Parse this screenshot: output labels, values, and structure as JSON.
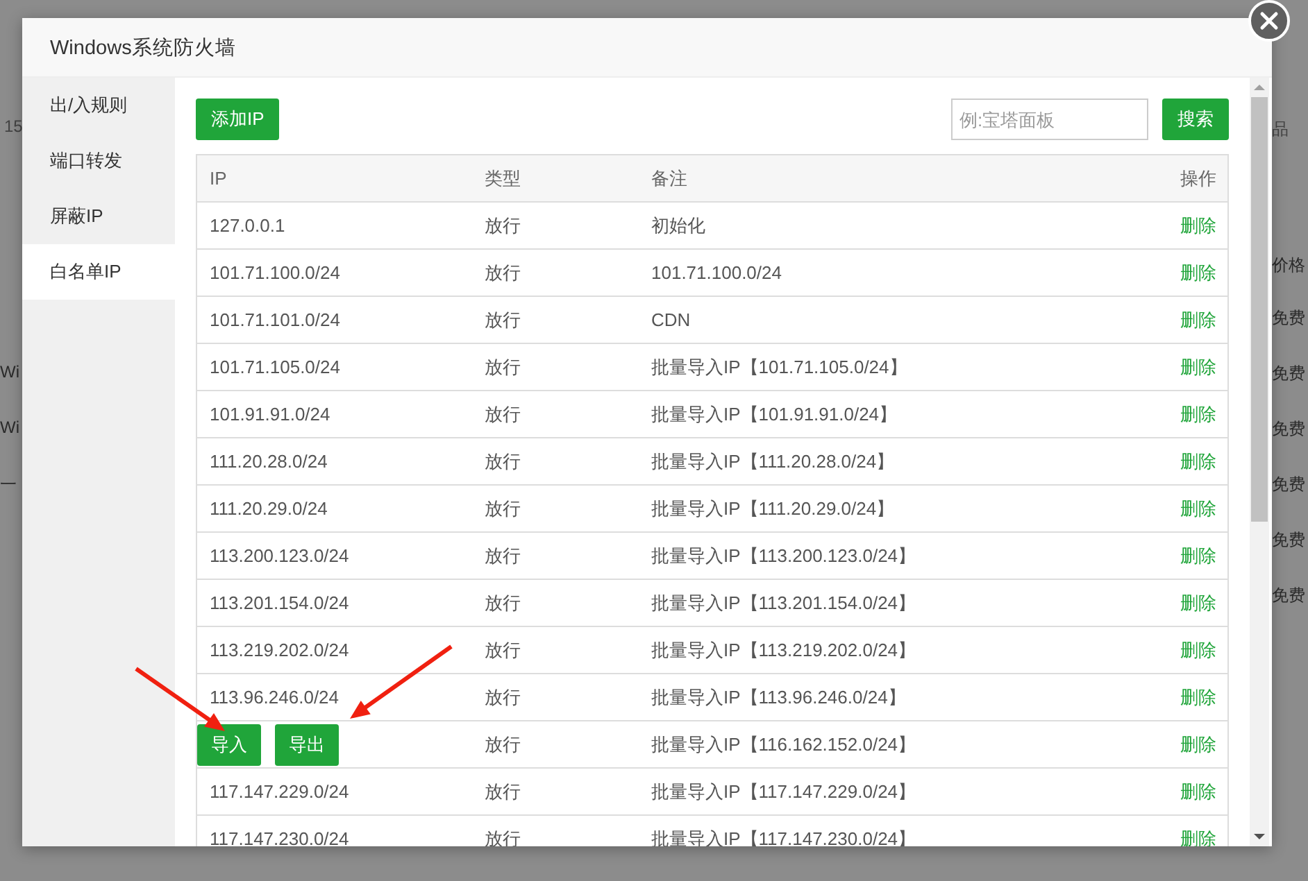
{
  "background": {
    "left_texts": [
      "15",
      "Wi",
      "Wi",
      "一"
    ],
    "right_texts": [
      "品",
      "价格",
      "免费",
      "免费",
      "免费",
      "免费",
      "免费",
      "免费"
    ]
  },
  "dialog": {
    "title": "Windows系统防火墙",
    "sidebar": [
      {
        "label": "出/入规则",
        "selected": false
      },
      {
        "label": "端口转发",
        "selected": false
      },
      {
        "label": "屏蔽IP",
        "selected": false
      },
      {
        "label": "白名单IP",
        "selected": true
      }
    ],
    "add_button": "添加IP",
    "search": {
      "placeholder": "例:宝塔面板"
    },
    "search_button": "搜索",
    "table": {
      "columns": [
        "IP",
        "类型",
        "备注",
        "操作"
      ],
      "rows": [
        {
          "ip": "127.0.0.1",
          "type": "放行",
          "note": "初始化",
          "action": "删除"
        },
        {
          "ip": "101.71.100.0/24",
          "type": "放行",
          "note": "101.71.100.0/24",
          "action": "删除"
        },
        {
          "ip": "101.71.101.0/24",
          "type": "放行",
          "note": "CDN",
          "action": "删除"
        },
        {
          "ip": "101.71.105.0/24",
          "type": "放行",
          "note": "批量导入IP【101.71.105.0/24】",
          "action": "删除"
        },
        {
          "ip": "101.91.91.0/24",
          "type": "放行",
          "note": "批量导入IP【101.91.91.0/24】",
          "action": "删除"
        },
        {
          "ip": "111.20.28.0/24",
          "type": "放行",
          "note": "批量导入IP【111.20.28.0/24】",
          "action": "删除"
        },
        {
          "ip": "111.20.29.0/24",
          "type": "放行",
          "note": "批量导入IP【111.20.29.0/24】",
          "action": "删除"
        },
        {
          "ip": "113.200.123.0/24",
          "type": "放行",
          "note": "批量导入IP【113.200.123.0/24】",
          "action": "删除"
        },
        {
          "ip": "113.201.154.0/24",
          "type": "放行",
          "note": "批量导入IP【113.201.154.0/24】",
          "action": "删除"
        },
        {
          "ip": "113.219.202.0/24",
          "type": "放行",
          "note": "批量导入IP【113.219.202.0/24】",
          "action": "删除"
        },
        {
          "ip": "113.96.246.0/24",
          "type": "放行",
          "note": "批量导入IP【113.96.246.0/24】",
          "action": "删除"
        },
        {
          "buttons": [
            "导入",
            "导出"
          ],
          "type": "放行",
          "note": "批量导入IP【116.162.152.0/24】",
          "action": "删除"
        },
        {
          "ip": "117.147.229.0/24",
          "type": "放行",
          "note": "批量导入IP【117.147.229.0/24】",
          "action": "删除"
        },
        {
          "ip": "117.147.230.0/24",
          "type": "放行",
          "note": "批量导入IP【117.147.230.0/24】",
          "action": "删除"
        }
      ]
    }
  }
}
